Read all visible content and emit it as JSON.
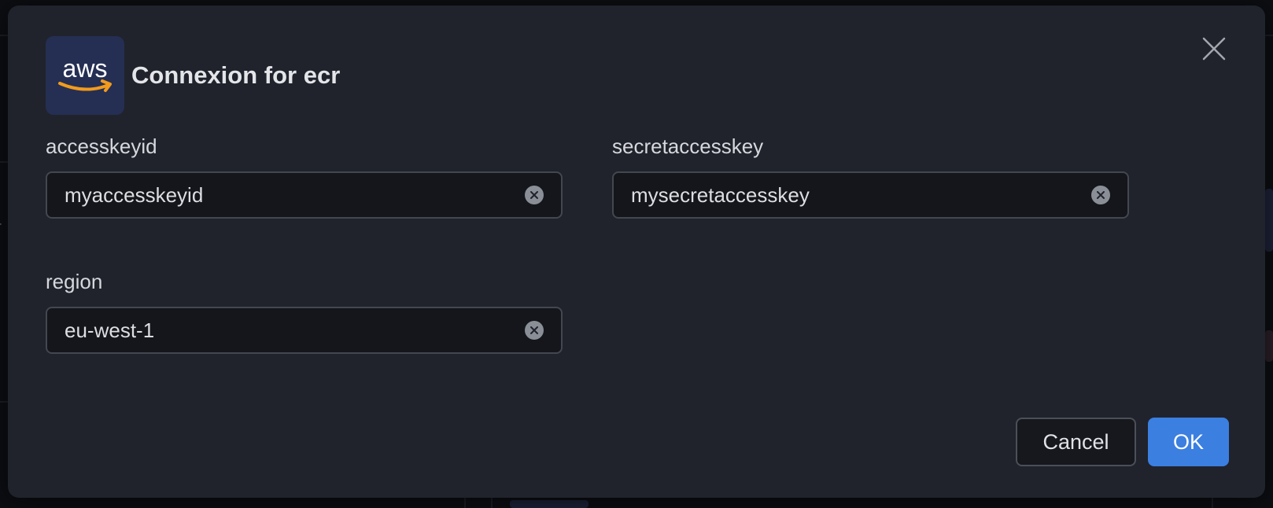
{
  "dialog": {
    "title": "Connexion for ecr",
    "logo_text": "aws",
    "fields": {
      "accesskeyid": {
        "label": "accesskeyid",
        "value": "myaccesskeyid"
      },
      "secretaccesskey": {
        "label": "secretaccesskey",
        "value": "mysecretaccesskey"
      },
      "region": {
        "label": "region",
        "value": "eu-west-1"
      }
    },
    "buttons": {
      "cancel": "Cancel",
      "ok": "OK"
    }
  },
  "colors": {
    "modal_bg": "#20232c",
    "input_bg": "#14161b",
    "primary": "#3b7fe0",
    "aws_orange": "#f29b1c"
  },
  "icons": {
    "close": "close-icon",
    "clear": "clear-input-icon",
    "logo": "aws-logo"
  }
}
